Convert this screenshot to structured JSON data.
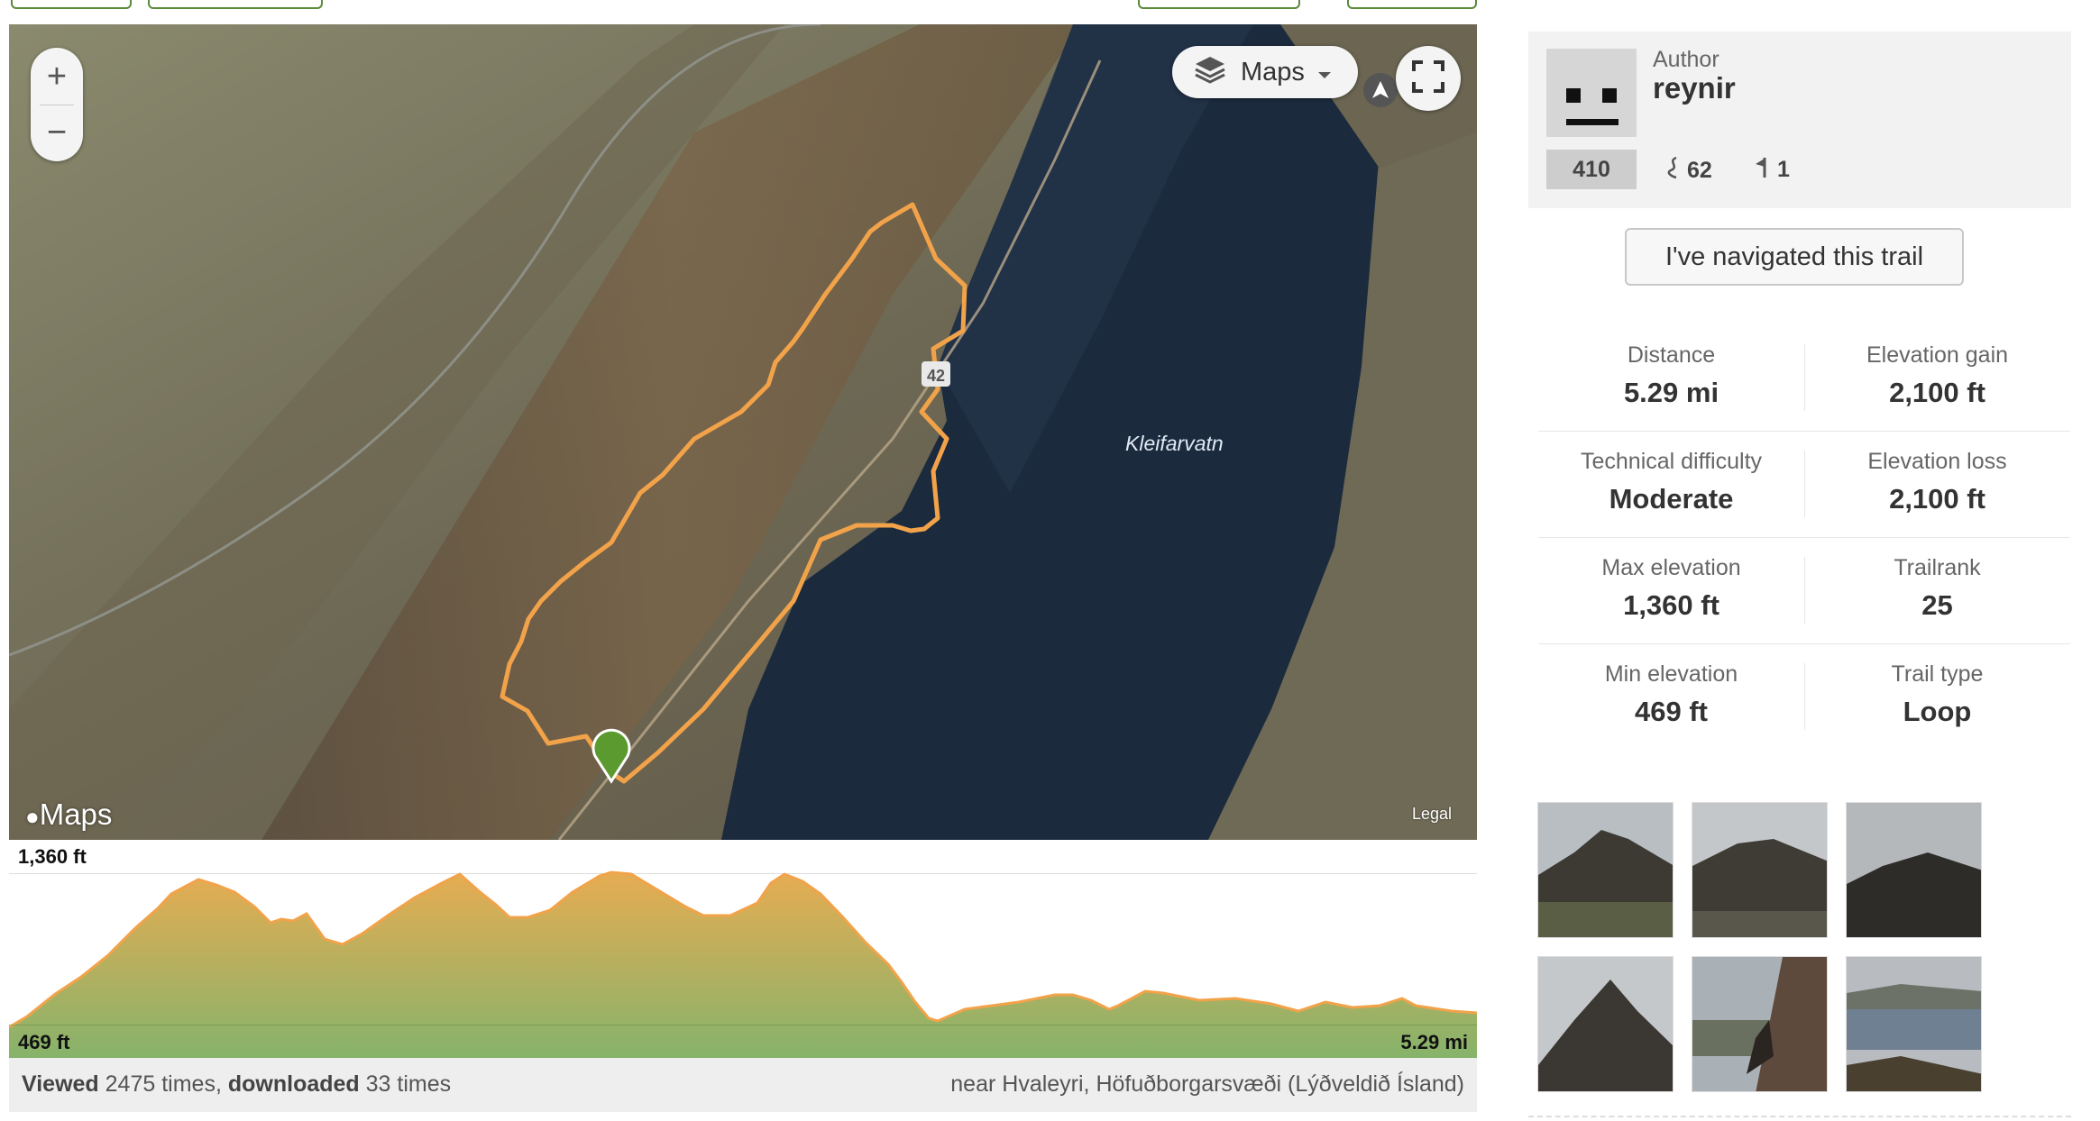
{
  "map": {
    "zoom_in_label": "+",
    "zoom_out_label": "−",
    "layer_label": "Maps",
    "lake_label": "Kleifarvatn",
    "attribution": "Maps",
    "legal": "Legal",
    "colors": {
      "track": "#f2a34a",
      "water": "#1a2a3e",
      "land": "#6b6a55",
      "marker": "#5a9a2e"
    }
  },
  "profile": {
    "max_label": "1,360 ft",
    "min_label": "469 ft",
    "distance_label": "5.29 mi",
    "colors": {
      "top": "#e3ad55",
      "bottom": "#8eb36a",
      "line": "#f2a34a"
    }
  },
  "stats_line": {
    "viewed_word": "Viewed",
    "viewed_count": "2475 times,",
    "downloaded_word": "downloaded",
    "downloaded_count": "33 times",
    "location": "near Hvaleyri, Höfuðborgarsvæði (Lýðveldið Ísland)"
  },
  "author": {
    "label": "Author",
    "name": "reynir",
    "rank": "410",
    "trails_count": "62",
    "flags_count": "1"
  },
  "nav_button": "I've navigated this trail",
  "stats": [
    {
      "label": "Distance",
      "value": "5.29 mi"
    },
    {
      "label": "Elevation gain",
      "value": "2,100 ft"
    },
    {
      "label": "Technical difficulty",
      "value": "Moderate"
    },
    {
      "label": "Elevation loss",
      "value": "2,100 ft"
    },
    {
      "label": "Max elevation",
      "value": "1,360 ft"
    },
    {
      "label": "Trailrank",
      "value": "25"
    },
    {
      "label": "Min elevation",
      "value": "469 ft"
    },
    {
      "label": "Trail type",
      "value": "Loop"
    }
  ]
}
